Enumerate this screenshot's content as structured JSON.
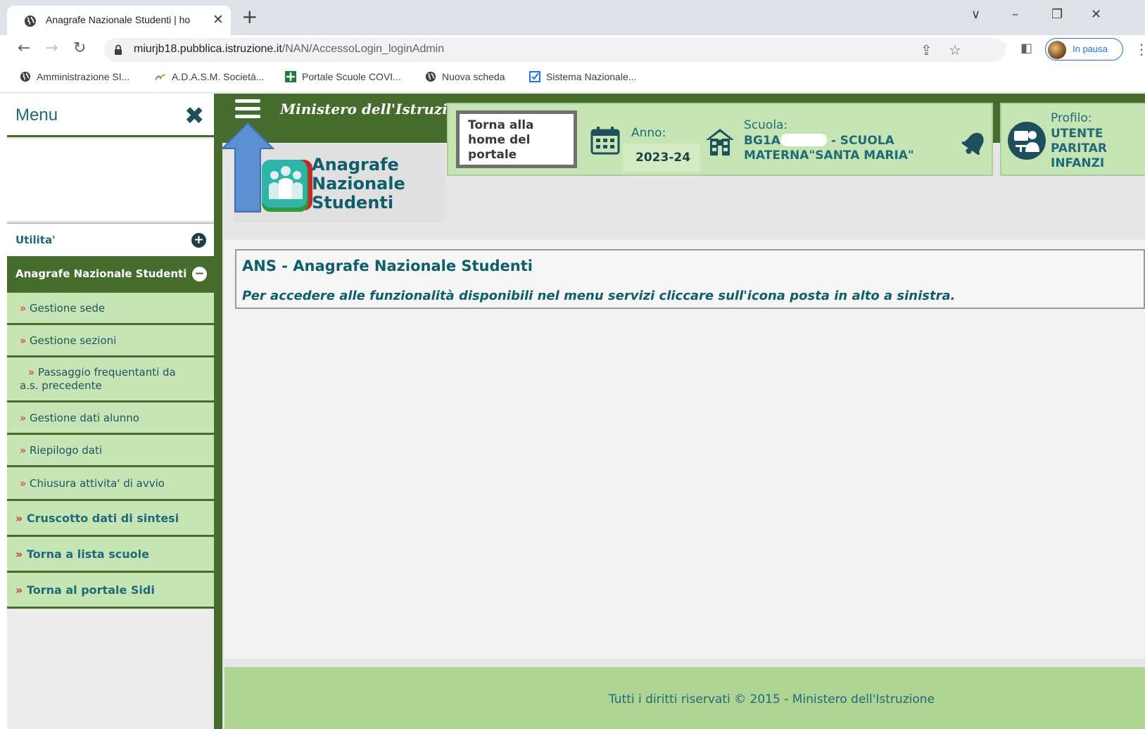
{
  "browser": {
    "tab_title": "Anagrafe Nazionale Studenti | ho",
    "tab_close": "✕",
    "new_tab": "+",
    "url_host": "miurjb18.pubblica.istruzione.it",
    "url_path": "/NAN/AccessoLogin_loginAdmin",
    "profile_status": "In pausa",
    "icons": [
      "globe-icon",
      "back-icon",
      "forward-icon",
      "reload-icon",
      "lock-icon",
      "share-icon",
      "star-icon",
      "side-panel-icon",
      "menu-icon"
    ],
    "bookmarks": [
      {
        "label": "Amministrazione SI...",
        "icon": "globe-icon"
      },
      {
        "label": "A.D.A.S.M. Società...",
        "icon": "adasm-icon"
      },
      {
        "label": "Portale Scuole COVI...",
        "icon": "covid-portal-icon"
      },
      {
        "label": "Nuova scheda",
        "icon": "globe-icon"
      },
      {
        "label": "Sistema Nazionale...",
        "icon": "checkbox-icon"
      }
    ]
  },
  "sidebar": {
    "title": "Menu",
    "close": "✖",
    "utilita": "Utilita'",
    "utilita_toggle": "+",
    "ans_section": "Anagrafe Nazionale Studenti",
    "ans_toggle": "−",
    "sub_items": [
      "Gestione sede",
      "Gestione sezioni",
      "Passaggio frequentanti da a.s. precedente",
      "Gestione dati alunno",
      "Riepilogo dati",
      "Chiusura attivita' di avvio"
    ],
    "main_items": [
      "Cruscotto dati di sintesi",
      "Torna a lista scuole",
      "Torna al portale Sidi"
    ],
    "bullet": "»"
  },
  "header": {
    "ministero": "Ministero dell'Istruzione",
    "logo_lines": [
      "Anagrafe",
      "Nazionale",
      "Studenti"
    ],
    "torna_home": "Torna alla home del portale",
    "anno_label": "Anno:",
    "anno_value": "2023-24",
    "scuola_label": "Scuola:",
    "scuola_code_prefix": "BG1A",
    "scuola_name": "- SCUOLA MATERNA\"SANTA MARIA\"",
    "profilo_label": "Profilo:",
    "profilo_lines": [
      "UTENTE",
      "PARITAR",
      "INFANZI"
    ]
  },
  "main": {
    "title": "ANS - Anagrafe Nazionale Studenti",
    "message": "Per accedere alle funzionalità disponibili nel menu servizi cliccare sull'icona posta in alto a sinistra."
  },
  "footer": {
    "text": "Tutti i diritti riservati © 2015 -  Ministero dell'Istruzione"
  },
  "colors": {
    "dark_green": "#456b2d",
    "light_green": "#c7e4b4",
    "teal": "#1f6b78",
    "annotation_arrow": "#5b8fd0"
  }
}
